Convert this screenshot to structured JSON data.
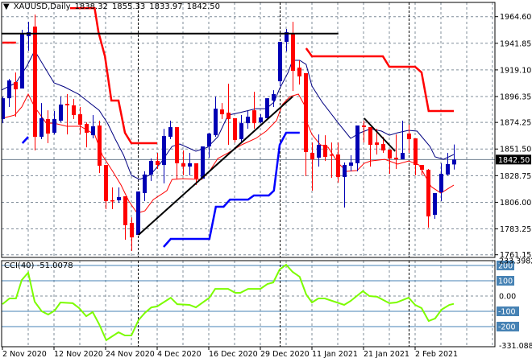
{
  "header": {
    "menu_icon": "triangle-down-icon",
    "symbol": "XAUUSD,Daily",
    "open": "1838.32",
    "high": "1855.33",
    "low": "1833.97",
    "close": "1842.50"
  },
  "indicator": {
    "label": "CCI(40) -51.0078"
  },
  "colors": {
    "bull": "#0000b4",
    "bear": "#ff0000",
    "ma_fast": "#000080",
    "ma_slow": "#ff0000",
    "channel_upper": "#ff0000",
    "channel_lower": "#0000ff",
    "trendline": "#000000",
    "cci": "#7cfc00",
    "cci_levels": "#4682b4",
    "grid": "#7f8c99",
    "price_line": "#708090"
  },
  "chart_data": [
    {
      "type": "candlestick",
      "title": "XAUUSD,Daily",
      "price_axis": {
        "ticks": [
          "1964.60",
          "1941.85",
          "1919.10",
          "1896.35",
          "1874.25",
          "1851.50",
          "1828.75",
          "1806.00",
          "1783.25",
          "1761.15"
        ],
        "ylim": [
          1761.15,
          1964.6
        ],
        "current_price": "1842.50"
      },
      "date_axis": {
        "labels": [
          {
            "bar": 0,
            "text": "2 Nov 2020"
          },
          {
            "bar": 8,
            "text": "12 Nov 2020"
          },
          {
            "bar": 16,
            "text": "24 Nov 2020"
          },
          {
            "bar": 24,
            "text": "4 Dec 2020"
          },
          {
            "bar": 32,
            "text": "16 Dec 2020"
          },
          {
            "bar": 40,
            "text": "29 Dec 2020"
          },
          {
            "bar": 48,
            "text": "11 Jan 2021"
          },
          {
            "bar": 56,
            "text": "21 Jan 2021"
          },
          {
            "bar": 64,
            "text": "2 Feb 2021"
          }
        ],
        "grid_every_bars": 4
      },
      "separators_bars": [
        21,
        43,
        63
      ],
      "ohlc": [
        [
          1877.1,
          1896.3,
          1873.6,
          1894.9
        ],
        [
          1894.9,
          1911.4,
          1887.4,
          1910.1
        ],
        [
          1908.7,
          1916.9,
          1879.1,
          1902.5
        ],
        [
          1903.2,
          1953.4,
          1903.2,
          1949.9
        ],
        [
          1947.9,
          1960.2,
          1935.5,
          1951.3
        ],
        [
          1956.1,
          1966.4,
          1850.3,
          1861.9
        ],
        [
          1861.9,
          1890.8,
          1859.9,
          1877.8
        ],
        [
          1877.1,
          1884.6,
          1856.5,
          1864.7
        ],
        [
          1865.4,
          1884.0,
          1864.0,
          1877.1
        ],
        [
          1875.7,
          1896.3,
          1874.3,
          1889.5
        ],
        [
          1890.1,
          1898.4,
          1864.0,
          1888.8
        ],
        [
          1888.8,
          1894.3,
          1877.1,
          1880.5
        ],
        [
          1881.2,
          1887.4,
          1864.0,
          1872.3
        ],
        [
          1872.9,
          1874.3,
          1853.0,
          1865.4
        ],
        [
          1863.3,
          1880.5,
          1860.6,
          1870.9
        ],
        [
          1871.6,
          1875.7,
          1831.0,
          1837.2
        ],
        [
          1837.9,
          1837.9,
          1800.1,
          1807.0
        ],
        [
          1807.7,
          1818.7,
          1800.1,
          1807.0
        ],
        [
          1807.7,
          1818.7,
          1805.6,
          1810.4
        ],
        [
          1811.1,
          1811.1,
          1774.0,
          1786.4
        ],
        [
          1788.4,
          1793.2,
          1764.4,
          1776.0
        ],
        [
          1778.1,
          1815.2,
          1778.1,
          1815.2
        ],
        [
          1813.9,
          1832.4,
          1807.0,
          1829.7
        ],
        [
          1829.7,
          1843.4,
          1824.2,
          1841.3
        ],
        [
          1841.3,
          1848.2,
          1834.5,
          1837.9
        ],
        [
          1837.9,
          1868.8,
          1822.1,
          1862.6
        ],
        [
          1861.9,
          1875.7,
          1859.9,
          1870.2
        ],
        [
          1870.2,
          1870.2,
          1825.5,
          1839.3
        ],
        [
          1839.3,
          1850.3,
          1829.0,
          1836.5
        ],
        [
          1836.5,
          1848.2,
          1829.0,
          1839.3
        ],
        [
          1839.3,
          1839.3,
          1820.7,
          1826.2
        ],
        [
          1826.2,
          1853.7,
          1826.2,
          1853.7
        ],
        [
          1853.7,
          1865.4,
          1844.1,
          1864.7
        ],
        [
          1863.3,
          1896.3,
          1861.9,
          1886.0
        ],
        [
          1885.3,
          1890.8,
          1877.1,
          1881.2
        ],
        [
          1882.6,
          1907.3,
          1855.1,
          1877.1
        ],
        [
          1877.8,
          1877.8,
          1857.1,
          1859.2
        ],
        [
          1859.9,
          1880.5,
          1857.1,
          1873.6
        ],
        [
          1873.6,
          1884.0,
          1868.8,
          1879.1
        ],
        [
          1884.6,
          1900.4,
          1868.8,
          1873.6
        ],
        [
          1874.3,
          1881.2,
          1873.6,
          1878.5
        ],
        [
          1877.8,
          1894.9,
          1877.8,
          1894.9
        ],
        [
          1892.9,
          1901.8,
          1887.4,
          1898.4
        ],
        [
          1909.4,
          1943.1,
          1905.3,
          1943.1
        ],
        [
          1943.1,
          1954.1,
          1934.8,
          1951.3
        ],
        [
          1950.6,
          1960.2,
          1901.1,
          1918.3
        ],
        [
          1921.1,
          1927.3,
          1906.6,
          1913.5
        ],
        [
          1916.3,
          1916.3,
          1828.3,
          1848.9
        ],
        [
          1848.2,
          1857.1,
          1815.9,
          1842.7
        ],
        [
          1844.1,
          1864.0,
          1836.5,
          1855.1
        ],
        [
          1855.1,
          1863.3,
          1841.3,
          1844.8
        ],
        [
          1846.8,
          1857.1,
          1826.9,
          1846.2
        ],
        [
          1846.8,
          1857.1,
          1822.8,
          1827.6
        ],
        [
          1827.6,
          1840.0,
          1801.5,
          1837.9
        ],
        [
          1837.2,
          1846.2,
          1832.4,
          1840.0
        ],
        [
          1839.3,
          1871.6,
          1832.4,
          1871.6
        ],
        [
          1871.6,
          1875.7,
          1857.1,
          1870.2
        ],
        [
          1870.2,
          1870.2,
          1836.5,
          1855.1
        ],
        [
          1857.1,
          1868.8,
          1846.8,
          1855.1
        ],
        [
          1855.8,
          1861.9,
          1848.2,
          1850.3
        ],
        [
          1851.0,
          1851.0,
          1830.3,
          1843.4
        ],
        [
          1844.1,
          1864.0,
          1834.5,
          1842.7
        ],
        [
          1842.7,
          1875.7,
          1842.7,
          1848.2
        ],
        [
          1864.7,
          1872.3,
          1848.2,
          1859.9
        ],
        [
          1860.6,
          1860.6,
          1829.0,
          1837.9
        ],
        [
          1837.9,
          1837.9,
          1829.0,
          1833.8
        ],
        [
          1833.8,
          1834.5,
          1784.3,
          1793.9
        ],
        [
          1795.3,
          1813.9,
          1791.9,
          1813.9
        ],
        [
          1814.5,
          1839.3,
          1807.0,
          1830.3
        ],
        [
          1829.7,
          1848.2,
          1829.0,
          1838.6
        ],
        [
          1838.32,
          1855.33,
          1833.97,
          1842.5
        ]
      ],
      "ma_fast": [
        [
          -0.4,
          1901.1
        ],
        [
          2.1,
          1908.0
        ],
        [
          3.8,
          1922.4
        ],
        [
          5,
          1935.5
        ],
        [
          6.8,
          1919.0
        ],
        [
          8,
          1908.0
        ],
        [
          9.6,
          1904.6
        ],
        [
          11.8,
          1898.4
        ],
        [
          13.4,
          1891.5
        ],
        [
          15,
          1884.6
        ],
        [
          16.3,
          1873.6
        ],
        [
          17.5,
          1859.9
        ],
        [
          18.8,
          1846.2
        ],
        [
          20,
          1829.0
        ],
        [
          21.3,
          1825.5
        ],
        [
          23,
          1829.7
        ],
        [
          24.6,
          1840.0
        ],
        [
          26.3,
          1853.7
        ],
        [
          27.5,
          1855.8
        ],
        [
          30,
          1849.6
        ],
        [
          31.8,
          1853.0
        ],
        [
          33.4,
          1861.9
        ],
        [
          35,
          1880.5
        ],
        [
          36.8,
          1882.6
        ],
        [
          39.3,
          1886.0
        ],
        [
          40.9,
          1886.0
        ],
        [
          42.1,
          1891.5
        ],
        [
          43,
          1903.2
        ],
        [
          44.3,
          1916.9
        ],
        [
          45,
          1927.3
        ],
        [
          46.1,
          1927.3
        ],
        [
          47.1,
          1923.8
        ],
        [
          48,
          1905.3
        ],
        [
          49.6,
          1891.5
        ],
        [
          52.1,
          1873.6
        ],
        [
          54,
          1860.6
        ],
        [
          55.5,
          1865.4
        ],
        [
          57.1,
          1868.8
        ],
        [
          58.8,
          1866.8
        ],
        [
          60,
          1863.3
        ],
        [
          61.3,
          1865.4
        ],
        [
          63,
          1867.5
        ],
        [
          64.3,
          1866.8
        ],
        [
          66.3,
          1853.7
        ],
        [
          67.1,
          1844.8
        ],
        [
          68.4,
          1842.7
        ],
        [
          70,
          1846.8
        ]
      ],
      "ma_slow": [
        [
          0,
          1877.8
        ],
        [
          1.9,
          1880.5
        ],
        [
          3,
          1887.4
        ],
        [
          4,
          1898.4
        ],
        [
          5,
          1887.4
        ],
        [
          6.8,
          1873.6
        ],
        [
          8,
          1873.6
        ],
        [
          10,
          1870.9
        ],
        [
          12.1,
          1870.9
        ],
        [
          14.3,
          1864.0
        ],
        [
          15.5,
          1846.2
        ],
        [
          17.1,
          1832.4
        ],
        [
          18.4,
          1820.7
        ],
        [
          19.6,
          1807.0
        ],
        [
          20.9,
          1796.7
        ],
        [
          22.1,
          1798.7
        ],
        [
          23.4,
          1808.3
        ],
        [
          25.5,
          1815.9
        ],
        [
          26.3,
          1825.5
        ],
        [
          28,
          1826.2
        ],
        [
          30.9,
          1825.5
        ],
        [
          32.1,
          1832.4
        ],
        [
          33.4,
          1843.4
        ],
        [
          35,
          1848.2
        ],
        [
          37.1,
          1855.1
        ],
        [
          39.3,
          1860.6
        ],
        [
          40.9,
          1866.8
        ],
        [
          42.5,
          1875.7
        ],
        [
          43.4,
          1889.5
        ],
        [
          44.6,
          1896.3
        ],
        [
          45.9,
          1898.4
        ],
        [
          46.8,
          1889.5
        ],
        [
          47.1,
          1875.7
        ],
        [
          48,
          1864.0
        ],
        [
          49.3,
          1855.1
        ],
        [
          50.5,
          1853.0
        ],
        [
          52.1,
          1839.3
        ],
        [
          53.4,
          1832.4
        ],
        [
          55,
          1833.1
        ],
        [
          56.1,
          1839.3
        ],
        [
          57.1,
          1841.3
        ],
        [
          59.3,
          1842.7
        ],
        [
          61.3,
          1838.6
        ],
        [
          63,
          1841.3
        ],
        [
          64.6,
          1837.9
        ],
        [
          66.5,
          1819.3
        ],
        [
          68,
          1813.9
        ],
        [
          70,
          1820.7
        ]
      ],
      "channel_upper": [
        [
          [
            0,
            1942.4
          ],
          [
            2.1,
            1942.4
          ]
        ],
        [
          [
            10.5,
            1971.9
          ],
          [
            14.3,
            1971.9
          ],
          [
            14.9,
            1951.3
          ],
          [
            15.9,
            1930.7
          ],
          [
            16.9,
            1892.9
          ],
          [
            18,
            1892.9
          ],
          [
            19,
            1865.4
          ],
          [
            20,
            1856.5
          ],
          [
            24,
            1856.5
          ]
        ],
        [
          [
            47.1,
            1937.6
          ],
          [
            48,
            1930.7
          ],
          [
            59,
            1930.7
          ],
          [
            60,
            1921.8
          ],
          [
            64,
            1921.8
          ],
          [
            65,
            1917.0
          ],
          [
            66.1,
            1884.0
          ],
          [
            70,
            1884.0
          ]
        ]
      ],
      "channel_lower": [
        [
          [
            3.1,
            1856.5
          ],
          [
            4,
            1861.9
          ]
        ],
        [
          [
            25,
            1767.8
          ],
          [
            26.1,
            1774.7
          ],
          [
            32.1,
            1774.7
          ],
          [
            33.1,
            1802.2
          ],
          [
            34.3,
            1802.2
          ],
          [
            35.3,
            1808.3
          ],
          [
            38.1,
            1808.3
          ],
          [
            39,
            1811.8
          ],
          [
            41.3,
            1811.8
          ],
          [
            42.1,
            1815.9
          ],
          [
            43,
            1855.1
          ],
          [
            44,
            1865.4
          ],
          [
            46.1,
            1865.4
          ]
        ]
      ],
      "trendlines": [
        [
          [
            -0.4,
            1950.1
          ],
          [
            52.1,
            1950.1
          ]
        ],
        [
          [
            21.1,
            1778.1
          ],
          [
            45,
            1896.3
          ]
        ],
        [
          [
            56.1,
            1877.8
          ],
          [
            60.9,
            1849.6
          ]
        ]
      ]
    },
    {
      "type": "line",
      "title": "CCI(40)",
      "ylim": [
        -331.088,
        233.3982
      ],
      "axis_labels": {
        "max": "233.3982",
        "min": "-331.088",
        "zero": "0.00"
      },
      "levels": [
        {
          "value": 200,
          "text": "200"
        },
        {
          "value": 100,
          "text": "100"
        },
        {
          "value": -100,
          "text": "-100"
        },
        {
          "value": -200,
          "text": "-200"
        }
      ],
      "last_value": -51.0078,
      "points": [
        [
          0,
          -53
        ],
        [
          1.1,
          -16
        ],
        [
          2.1,
          -16
        ],
        [
          3,
          105
        ],
        [
          4,
          153
        ],
        [
          5,
          -37
        ],
        [
          6.1,
          -100
        ],
        [
          7.1,
          -121
        ],
        [
          8.1,
          -95
        ],
        [
          9,
          -42
        ],
        [
          10.9,
          -47
        ],
        [
          11.9,
          -79
        ],
        [
          13,
          -132
        ],
        [
          14,
          -105
        ],
        [
          15,
          -184
        ],
        [
          16.1,
          -289
        ],
        [
          18,
          -237
        ],
        [
          19,
          -258
        ],
        [
          20,
          -258
        ],
        [
          21.1,
          -158
        ],
        [
          22.1,
          -110
        ],
        [
          23.1,
          -74
        ],
        [
          24,
          -68
        ],
        [
          26.1,
          -11
        ],
        [
          27.1,
          -53
        ],
        [
          29,
          -58
        ],
        [
          30,
          -74
        ],
        [
          32.1,
          -11
        ],
        [
          33,
          47
        ],
        [
          35,
          47
        ],
        [
          36.1,
          21
        ],
        [
          36.9,
          21
        ],
        [
          38.1,
          47
        ],
        [
          40,
          47
        ],
        [
          41.1,
          79
        ],
        [
          42,
          89
        ],
        [
          43,
          174
        ],
        [
          44,
          205
        ],
        [
          45,
          158
        ],
        [
          46.1,
          126
        ],
        [
          47.1,
          11
        ],
        [
          48,
          -42
        ],
        [
          49,
          -16
        ],
        [
          50,
          -16
        ],
        [
          53,
          -58
        ],
        [
          54,
          -32
        ],
        [
          55.9,
          32
        ],
        [
          56.9,
          0
        ],
        [
          58.1,
          -5
        ],
        [
          60,
          -47
        ],
        [
          61.1,
          -42
        ],
        [
          63,
          -11
        ],
        [
          64,
          -58
        ],
        [
          65,
          -79
        ],
        [
          66.1,
          -163
        ],
        [
          67.1,
          -147
        ],
        [
          68.1,
          -89
        ],
        [
          69.3,
          -58
        ],
        [
          70,
          -51
        ]
      ]
    }
  ]
}
